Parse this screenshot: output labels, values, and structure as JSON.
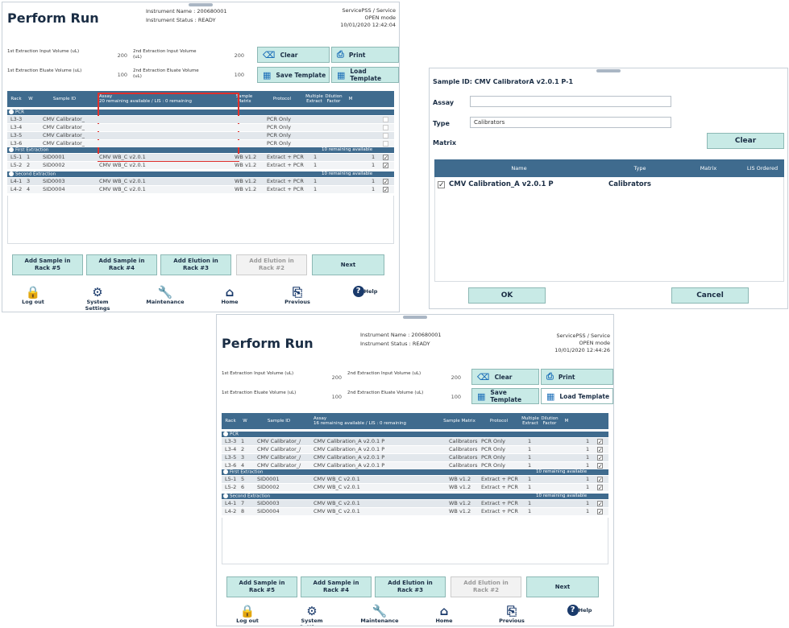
{
  "top_window": {
    "title": "Perform Run",
    "instrument_name": "Instrument Name : 200680001",
    "instrument_status": "Instrument Status : READY",
    "user": "ServicePSS / Service",
    "mode": "OPEN mode",
    "datetime": "10/01/2020 12:42:04",
    "fields": {
      "ext1_input_label": "1st Extraction Input Volume (uL)",
      "ext1_input_value": "200",
      "ext2_input_label": "2nd Extraction Input Volume (uL)",
      "ext2_input_value": "200",
      "ext1_eluate_label": "1st Extraction Eluate Volume (uL)",
      "ext1_eluate_value": "100",
      "ext2_eluate_label": "2nd Extraction Eluate Volume (uL)",
      "ext2_eluate_value": "100"
    },
    "buttons": {
      "clear": "Clear",
      "print": "Print",
      "save_template": "Save Template",
      "load_template": "Load Template"
    },
    "headers": {
      "rack": "Rack",
      "w": "W",
      "sample_id": "Sample ID",
      "assay": "Assay",
      "assay_sub": "20 remaining available / LIS : 0 remaining",
      "sample_matrix": "Sample Matrix",
      "protocol": "Protocol",
      "multiple_extract": "Multiple Extract",
      "dilution_factor": "Dilution Factor",
      "m": "M"
    },
    "groups": {
      "pcr": "PCR",
      "first": "First Extraction",
      "second": "Second Extraction",
      "first_remaining": "10 remaining available",
      "second_remaining": "10 remaining available"
    },
    "pcr_rows": [
      {
        "rack": "L3-3",
        "sample": "CMV Calibrator_",
        "protocol": "PCR Only"
      },
      {
        "rack": "L3-4",
        "sample": "CMV Calibrator_",
        "protocol": "PCR Only"
      },
      {
        "rack": "L3-5",
        "sample": "CMV Calibrator_",
        "protocol": "PCR Only"
      },
      {
        "rack": "L3-6",
        "sample": "CMV Calibrator_",
        "protocol": "PCR Only"
      }
    ],
    "first_rows": [
      {
        "rack": "L5-1",
        "w": "1",
        "sample": "SID0001",
        "assay": "CMV WB_C v2.0.1",
        "matrix": "WB v1.2",
        "protocol": "Extract + PCR",
        "multi": "1",
        "dil": "1"
      },
      {
        "rack": "L5-2",
        "w": "2",
        "sample": "SID0002",
        "assay": "CMV WB_C v2.0.1",
        "matrix": "WB v1.2",
        "protocol": "Extract + PCR",
        "multi": "1",
        "dil": "1"
      }
    ],
    "second_rows": [
      {
        "rack": "L4-1",
        "w": "3",
        "sample": "SID0003",
        "assay": "CMV WB_C v2.0.1",
        "matrix": "WB v1.2",
        "protocol": "Extract + PCR",
        "multi": "1",
        "dil": "1"
      },
      {
        "rack": "L4-2",
        "w": "4",
        "sample": "SID0004",
        "assay": "CMV WB_C v2.0.1",
        "matrix": "WB v1.2",
        "protocol": "Extract + PCR",
        "multi": "1",
        "dil": "1"
      }
    ],
    "bottom_buttons": [
      "Add Sample in Rack #5",
      "Add Sample in Rack #4",
      "Add Elution in Rack #3",
      "Add Elution in Rack #2",
      "Next"
    ],
    "nav": [
      "Log out",
      "System Settings",
      "Maintenance",
      "Home",
      "Previous",
      "Help"
    ]
  },
  "dialog": {
    "title": "Sample ID: CMV CalibratorA v2.0.1 P-1",
    "assay_label": "Assay",
    "assay_value": "",
    "type_label": "Type",
    "type_value": "Calibrators",
    "matrix_label": "Matrix",
    "clear": "Clear",
    "headers": {
      "name": "Name",
      "type": "Type",
      "matrix": "Matrix",
      "lis": "LIS Ordered"
    },
    "row": {
      "name": "CMV Calibration_A v2.0.1 P",
      "type": "Calibrators"
    },
    "ok": "OK",
    "cancel": "Cancel"
  },
  "bottom_window": {
    "title": "Perform Run",
    "instrument_name": "Instrument Name : 200680001",
    "instrument_status": "Instrument Status : READY",
    "user": "ServicePSS / Service",
    "mode": "OPEN mode",
    "datetime": "10/01/2020 12:44:26",
    "assay_sub": "16 remaining available / LIS : 0 remaining",
    "pcr_rows": [
      {
        "rack": "L3-3",
        "w": "1",
        "sample": "CMV Calibrator_/",
        "assay": "CMV Calibration_A v2.0.1 P",
        "matrix": "Calibrators",
        "protocol": "PCR Only",
        "multi": "1",
        "dil": "1"
      },
      {
        "rack": "L3-4",
        "w": "2",
        "sample": "CMV Calibrator_/",
        "assay": "CMV Calibration_A v2.0.1 P",
        "matrix": "Calibrators",
        "protocol": "PCR Only",
        "multi": "1",
        "dil": "1"
      },
      {
        "rack": "L3-5",
        "w": "3",
        "sample": "CMV Calibrator_/",
        "assay": "CMV Calibration_A v2.0.1 P",
        "matrix": "Calibrators",
        "protocol": "PCR Only",
        "multi": "1",
        "dil": "1"
      },
      {
        "rack": "L3-6",
        "w": "4",
        "sample": "CMV Calibrator_/",
        "assay": "CMV Calibration_A v2.0.1 P",
        "matrix": "Calibrators",
        "protocol": "PCR Only",
        "multi": "1",
        "dil": "1"
      }
    ],
    "first_rows": [
      {
        "rack": "L5-1",
        "w": "5",
        "sample": "SID0001",
        "assay": "CMV WB_C v2.0.1",
        "matrix": "WB v1.2",
        "protocol": "Extract + PCR",
        "multi": "1",
        "dil": "1"
      },
      {
        "rack": "L5-2",
        "w": "6",
        "sample": "SID0002",
        "assay": "CMV WB_C v2.0.1",
        "matrix": "WB v1.2",
        "protocol": "Extract + PCR",
        "multi": "1",
        "dil": "1"
      }
    ],
    "second_rows": [
      {
        "rack": "L4-1",
        "w": "7",
        "sample": "SID0003",
        "assay": "CMV WB_C v2.0.1",
        "matrix": "WB v1.2",
        "protocol": "Extract + PCR",
        "multi": "1",
        "dil": "1"
      },
      {
        "rack": "L4-2",
        "w": "8",
        "sample": "SID0004",
        "assay": "CMV WB_C v2.0.1",
        "matrix": "WB v1.2",
        "protocol": "Extract + PCR",
        "multi": "1",
        "dil": "1"
      }
    ]
  }
}
